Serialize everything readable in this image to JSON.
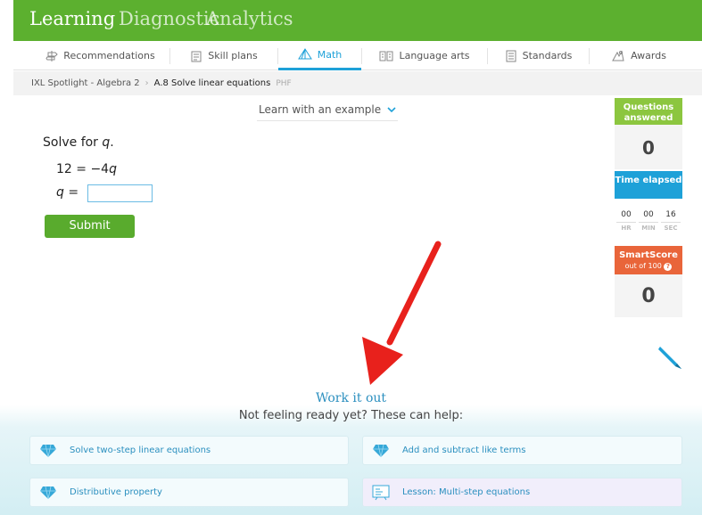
{
  "topnav": {
    "items": [
      "Learning",
      "Diagnostic",
      "Analytics"
    ]
  },
  "subnav": {
    "tabs": [
      {
        "label": "Recommendations",
        "icon": "signpost-icon"
      },
      {
        "label": "Skill plans",
        "icon": "skill-plans-icon"
      },
      {
        "label": "Math",
        "icon": "pyramid-icon"
      },
      {
        "label": "Language arts",
        "icon": "book-icon"
      },
      {
        "label": "Standards",
        "icon": "standards-icon"
      },
      {
        "label": "Awards",
        "icon": "awards-icon"
      }
    ],
    "active": "Math"
  },
  "breadcrumb": {
    "root": "IXL Spotlight - Algebra 2",
    "current": "A.8 Solve linear equations",
    "tag": "PHF"
  },
  "learn_link": "Learn with an example",
  "problem": {
    "prompt_prefix": "Solve for ",
    "variable": "q",
    "prompt_suffix": ".",
    "equation_left": "12 = ",
    "equation_coeff": "−4",
    "equation_var": "q",
    "answer_var": "q",
    "answer_equals": " =",
    "answer_value": "",
    "submit_label": "Submit"
  },
  "stats": {
    "questions_label": "Questions answered",
    "questions_value": "0",
    "time_label": "Time elapsed",
    "timer": [
      {
        "value": "00",
        "unit": "HR"
      },
      {
        "value": "00",
        "unit": "MIN"
      },
      {
        "value": "16",
        "unit": "SEC"
      }
    ],
    "smartscore_label": "SmartScore",
    "smartscore_sub": "out of 100",
    "smartscore_value": "0"
  },
  "help": {
    "heading": "Work it out",
    "subheading": "Not feeling ready yet? These can help:",
    "cards": [
      {
        "label": "Solve two-step linear equations",
        "icon": "gem-icon"
      },
      {
        "label": "Add and subtract like terms",
        "icon": "gem-icon"
      },
      {
        "label": "Distributive property",
        "icon": "gem-icon"
      },
      {
        "label": "Lesson: Multi-step equations",
        "icon": "lesson-icon"
      }
    ]
  },
  "colors": {
    "brand_green": "#5cb02f",
    "accent_blue": "#1ea1d8",
    "smartscore_orange": "#e9653a",
    "annotation_red": "#e8211c"
  }
}
